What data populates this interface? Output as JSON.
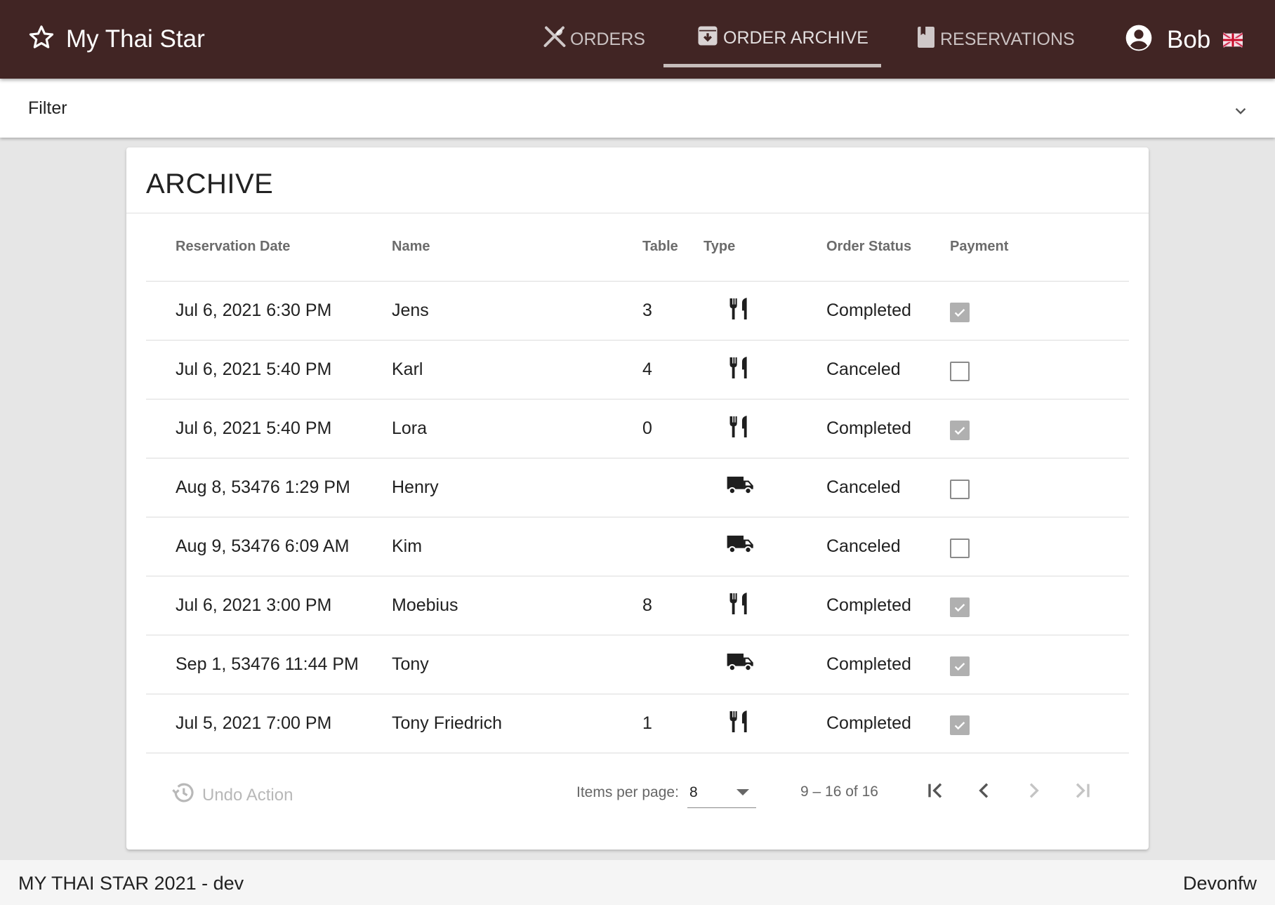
{
  "app": {
    "title": "My Thai Star",
    "brand_icon": "star-outline-icon"
  },
  "nav": {
    "tabs": [
      {
        "label": "ORDERS",
        "icon": "cutlery-cross-icon"
      },
      {
        "label": "ORDER ARCHIVE",
        "icon": "archive-box-icon",
        "active": true
      },
      {
        "label": "RESERVATIONS",
        "icon": "bookmark-book-icon"
      }
    ],
    "user": {
      "name": "Bob",
      "icon": "account-circle-icon",
      "language": "en-gb-flag-icon"
    }
  },
  "filter": {
    "label": "Filter"
  },
  "archive": {
    "title": "ARCHIVE",
    "columns": [
      "Reservation Date",
      "Name",
      "Table",
      "Type",
      "Order Status",
      "Payment"
    ],
    "rows": [
      {
        "date": "Jul 6, 2021 6:30 PM",
        "name": "Jens",
        "table": "3",
        "type": "dine-in",
        "status": "Completed",
        "paid": true
      },
      {
        "date": "Jul 6, 2021 5:40 PM",
        "name": "Karl",
        "table": "4",
        "type": "dine-in",
        "status": "Canceled",
        "paid": false
      },
      {
        "date": "Jul 6, 2021 5:40 PM",
        "name": "Lora",
        "table": "0",
        "type": "dine-in",
        "status": "Completed",
        "paid": true
      },
      {
        "date": "Aug 8, 53476 1:29 PM",
        "name": "Henry",
        "table": "",
        "type": "delivery",
        "status": "Canceled",
        "paid": false
      },
      {
        "date": "Aug 9, 53476 6:09 AM",
        "name": "Kim",
        "table": "",
        "type": "delivery",
        "status": "Canceled",
        "paid": false
      },
      {
        "date": "Jul 6, 2021 3:00 PM",
        "name": "Moebius",
        "table": "8",
        "type": "dine-in",
        "status": "Completed",
        "paid": true
      },
      {
        "date": "Sep 1, 53476 11:44 PM",
        "name": "Tony",
        "table": "",
        "type": "delivery",
        "status": "Completed",
        "paid": true
      },
      {
        "date": "Jul 5, 2021 7:00 PM",
        "name": "Tony Friedrich",
        "table": "1",
        "type": "dine-in",
        "status": "Completed",
        "paid": true
      }
    ],
    "undo_label": "Undo Action",
    "paginator": {
      "items_per_page_label": "Items per page:",
      "items_per_page": "8",
      "range": "9 – 16 of 16"
    }
  },
  "footer": {
    "left": "MY THAI STAR 2021 - dev",
    "right": "Devonfw"
  },
  "colors": {
    "header": "#412524",
    "background": "#e6e6e6",
    "card": "#ffffff"
  }
}
